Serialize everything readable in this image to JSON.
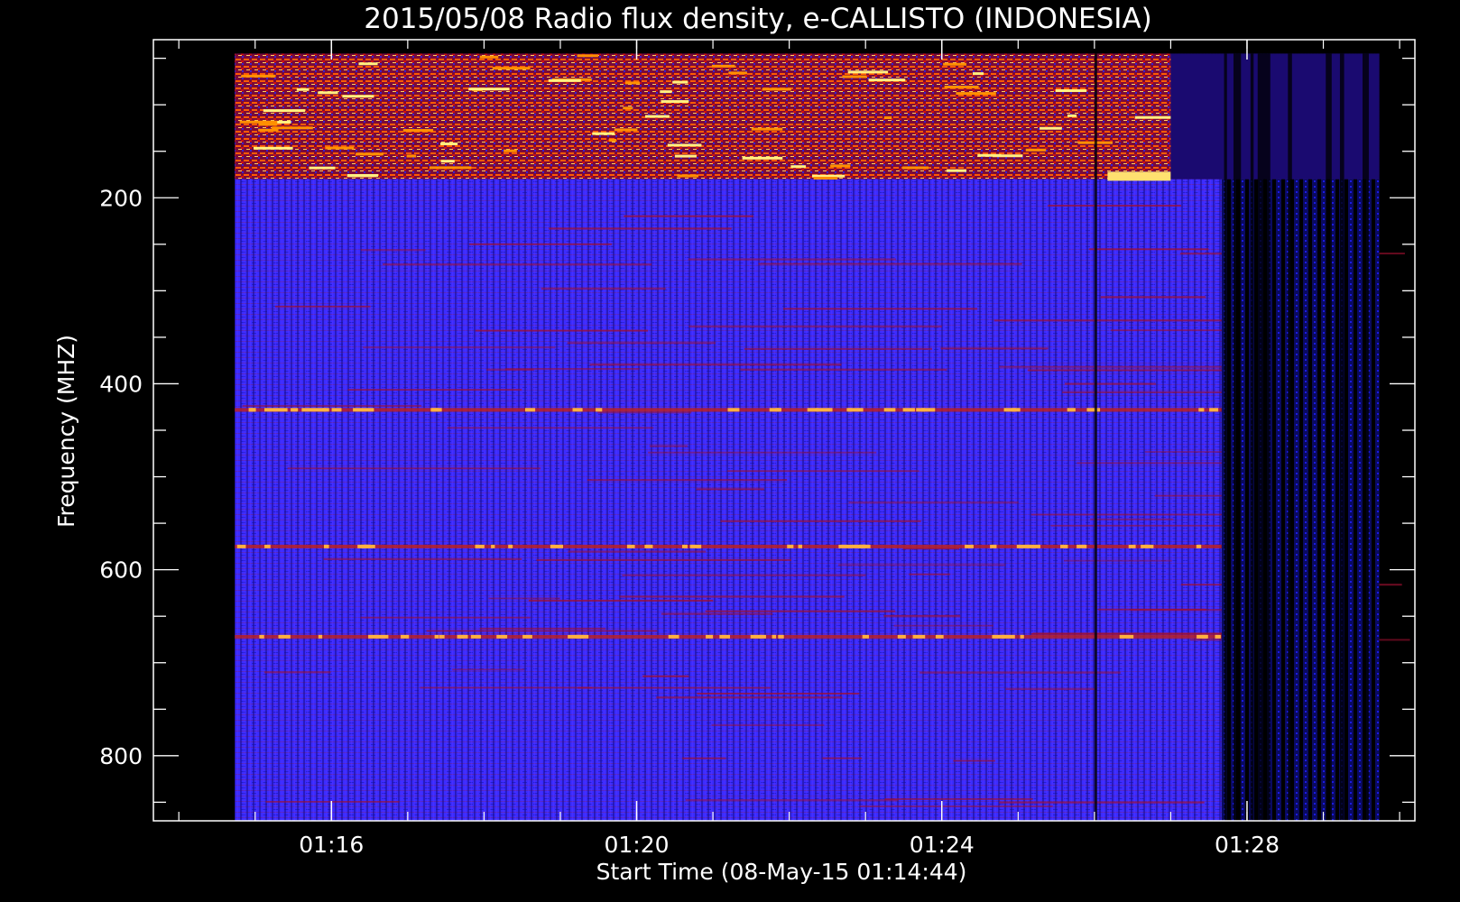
{
  "chart_data": {
    "type": "heatmap",
    "title": "2015/05/08  Radio flux density, e-CALLISTO (INDONESIA)",
    "xlabel": "Start Time (08-May-15 01:14:44)",
    "ylabel": "Frequency (MHZ)",
    "x_unit": "minutes (UT)",
    "xlim": [
      "01:13:40",
      "01:30:12"
    ],
    "ylim": [
      870,
      30
    ],
    "y_inverted": true,
    "data_time_range": [
      "01:14:44",
      "01:29:44"
    ],
    "data_freq_range": [
      45,
      870
    ],
    "x_ticks": [
      "01:16",
      "01:20",
      "01:24",
      "01:28"
    ],
    "y_ticks": [
      200,
      400,
      600,
      800
    ],
    "colormap": [
      "#000000",
      "#1010d0",
      "#3a2cff",
      "#cc1010",
      "#ff7a00",
      "#fff080"
    ],
    "features": [
      {
        "label": "intense emission band",
        "freq_range": [
          45,
          180
        ],
        "time_range": [
          "01:14:44",
          "01:27:00"
        ]
      },
      {
        "label": "narrowband line",
        "freq": 575
      },
      {
        "label": "narrowband line",
        "freq": 428
      },
      {
        "label": "narrowband line",
        "freq": 672
      },
      {
        "label": "data dropout / low signal region",
        "time_range": [
          "01:27:40",
          "01:29:44"
        ]
      },
      {
        "label": "vertical gap",
        "time": "01:26:00"
      }
    ],
    "grid": false,
    "legend": "none"
  },
  "colors": {
    "background": "#000000",
    "axes": "#ffffff",
    "text": "#ffffff"
  }
}
